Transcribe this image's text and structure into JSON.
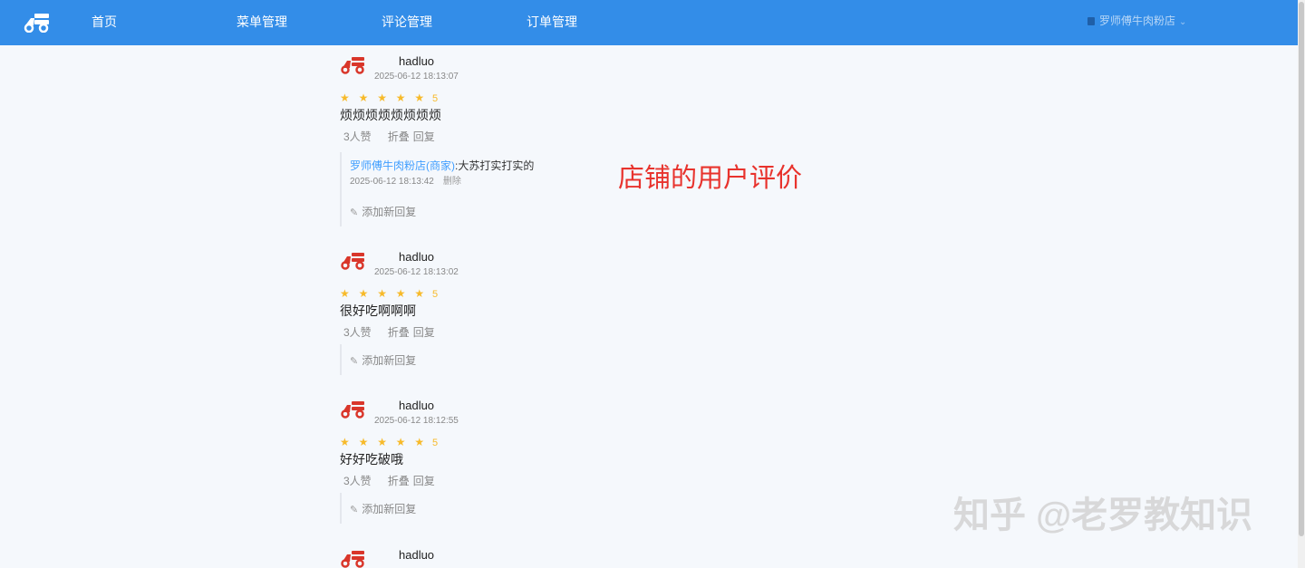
{
  "nav": {
    "items": [
      "首页",
      "菜单管理",
      "评论管理",
      "订单管理"
    ],
    "shop_name": "罗师傅牛肉粉店",
    "accent": "#338de8"
  },
  "reviews": [
    {
      "username": "hadluo",
      "time": "2025-06-12 18:13:07",
      "rating": 5,
      "score_label": "5",
      "text": "烦烦烦烦烦烦烦烦",
      "likes": "3人赞",
      "fold": "折叠",
      "reply": "回复",
      "replies": [
        {
          "shop_name": "罗师傅牛肉粉店(商家)",
          "content": ":大苏打实打实的",
          "time": "2025-06-12 18:13:42",
          "delete": "删除"
        }
      ],
      "add_reply": "添加新回复"
    },
    {
      "username": "hadluo",
      "time": "2025-06-12 18:13:02",
      "rating": 5,
      "score_label": "5",
      "text": "很好吃啊啊啊",
      "likes": "3人赞",
      "fold": "折叠",
      "reply": "回复",
      "replies": [],
      "add_reply": "添加新回复"
    },
    {
      "username": "hadluo",
      "time": "2025-06-12 18:12:55",
      "rating": 5,
      "score_label": "5",
      "text": "好好吃破哦",
      "likes": "3人赞",
      "fold": "折叠",
      "reply": "回复",
      "replies": [],
      "add_reply": "添加新回复"
    },
    {
      "username": "hadluo"
    }
  ],
  "annotation": "店铺的用户评价",
  "watermark": "知乎 @老罗教知识",
  "colors": {
    "star": "#f7ba2a",
    "shop_link": "#409eff",
    "annotation": "#e8332d"
  }
}
